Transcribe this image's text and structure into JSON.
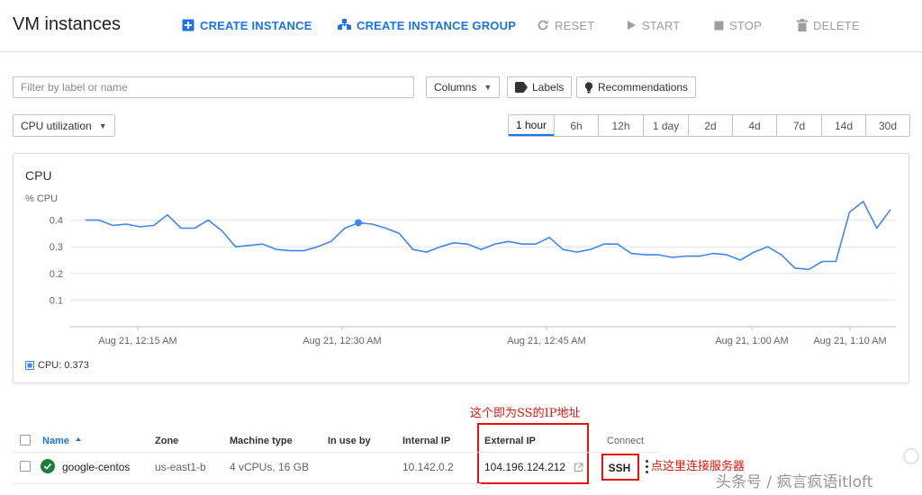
{
  "header": {
    "title": "VM instances",
    "create_instance": "CREATE INSTANCE",
    "create_group": "CREATE INSTANCE GROUP",
    "reset": "RESET",
    "start": "START",
    "stop": "STOP",
    "delete": "DELETE"
  },
  "filter": {
    "placeholder": "Filter by label or name",
    "columns": "Columns",
    "labels": "Labels",
    "recommendations": "Recommendations"
  },
  "metric_select": "CPU utilization",
  "time_range": {
    "options": [
      "1 hour",
      "6h",
      "12h",
      "1 day",
      "2d",
      "4d",
      "7d",
      "14d",
      "30d"
    ],
    "selected": "1 hour"
  },
  "chart_card": {
    "title": "CPU",
    "unit": "% CPU",
    "legend": "CPU: 0.373"
  },
  "chart_data": {
    "type": "line",
    "ylabel": "% CPU",
    "ylim": [
      0,
      0.5
    ],
    "y_ticks": [
      "0.1",
      "0.2",
      "0.3",
      "0.4"
    ],
    "x_ticks": [
      "Aug 21, 12:15 AM",
      "Aug 21, 12:30 AM",
      "Aug 21, 12:45 AM",
      "Aug 21, 1:00 AM",
      "Aug 21, 1:10 AM"
    ],
    "series": [
      {
        "name": "CPU",
        "color": "#4285f4",
        "highlight_index": 20,
        "values": [
          0.4,
          0.4,
          0.38,
          0.385,
          0.375,
          0.38,
          0.42,
          0.37,
          0.37,
          0.4,
          0.36,
          0.3,
          0.305,
          0.31,
          0.29,
          0.285,
          0.285,
          0.3,
          0.32,
          0.37,
          0.39,
          0.385,
          0.37,
          0.35,
          0.29,
          0.28,
          0.3,
          0.315,
          0.31,
          0.29,
          0.31,
          0.32,
          0.31,
          0.31,
          0.335,
          0.29,
          0.28,
          0.29,
          0.31,
          0.31,
          0.275,
          0.27,
          0.27,
          0.26,
          0.265,
          0.265,
          0.275,
          0.27,
          0.25,
          0.28,
          0.3,
          0.27,
          0.22,
          0.215,
          0.245,
          0.245,
          0.43,
          0.47,
          0.37,
          0.44
        ]
      }
    ]
  },
  "annotations": {
    "external_ip_note": "这个即为SS的IP地址",
    "ssh_note": "点这里连接服务器",
    "watermark": "头条号 / 疯言疯语itloft"
  },
  "table": {
    "headers": {
      "name": "Name",
      "sort_icon": "arrow-up",
      "zone": "Zone",
      "machine_type": "Machine type",
      "in_use_by": "In use by",
      "internal_ip": "Internal IP",
      "external_ip": "External IP",
      "connect": "Connect"
    },
    "rows": [
      {
        "status": "running",
        "name": "google-centos",
        "zone": "us-east1-b",
        "machine_type": "4 vCPUs, 16 GB",
        "in_use_by": "",
        "internal_ip": "10.142.0.2",
        "external_ip": "104.196.124.212",
        "connect": "SSH"
      }
    ]
  },
  "colors": {
    "primary": "#1a73e8",
    "series": "#4285f4",
    "annotation": "#e8130d",
    "running": "#188038"
  }
}
